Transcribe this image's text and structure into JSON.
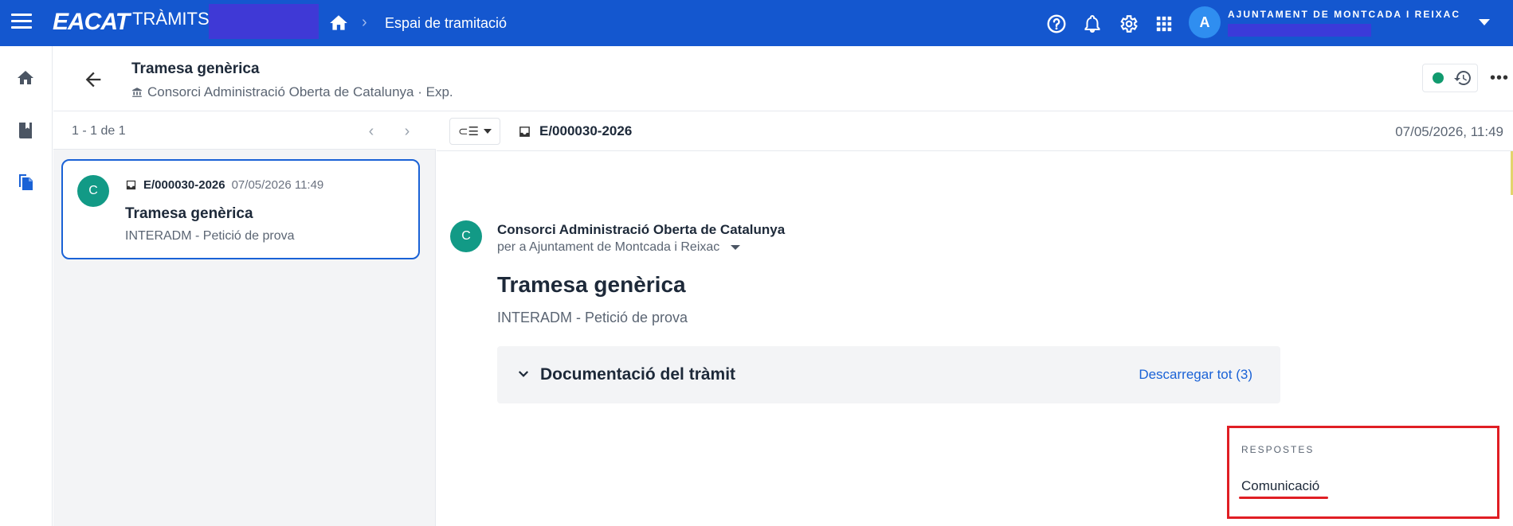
{
  "topbar": {
    "logo_main": "EACAT",
    "logo_sub": "TRÀMITS",
    "breadcrumb": "Espai de tramitació",
    "org_initial": "A",
    "org_name": "AJUNTAMENT DE MONTCADA I REIXAC",
    "icons": [
      "help-icon",
      "bell-icon",
      "gear-icon",
      "apps-grid-icon"
    ]
  },
  "rail": {
    "items": [
      "home-icon",
      "book-icon",
      "documents-icon"
    ],
    "active": "documents-icon"
  },
  "header": {
    "title": "Tramesa genèrica",
    "subtitle": "Consorci Administració Oberta de Catalunya · Exp.",
    "status_color": "#119a6e",
    "more": "•••"
  },
  "list": {
    "count": "1 - 1 de 1",
    "prev": "‹",
    "next": "›",
    "cards": [
      {
        "initial": "C",
        "code": "E/000030-2026",
        "date": "07/05/2026 11:49",
        "title": "Tramesa genèrica",
        "desc": "INTERADM - Petició de prova"
      }
    ]
  },
  "detail": {
    "filter_glyph": "⊂☰",
    "code": "E/000030-2026",
    "date": "07/05/2026, 11:49",
    "message": {
      "initial": "C",
      "from": "Consorci Administració Oberta de Catalunya",
      "to": "per a Ajuntament de Montcada i Reixac",
      "title": "Tramesa genèrica",
      "desc": "INTERADM - Petició de prova"
    },
    "docs": {
      "title": "Documentació del tràmit",
      "download": "Descarregar tot (3)"
    }
  },
  "responses": {
    "label": "RESPOSTES",
    "item": "Comunicació"
  },
  "colors": {
    "brand": "#1457cf",
    "link": "#1a62d6",
    "avatar": "#129a86",
    "highlight": "#e01e24"
  }
}
